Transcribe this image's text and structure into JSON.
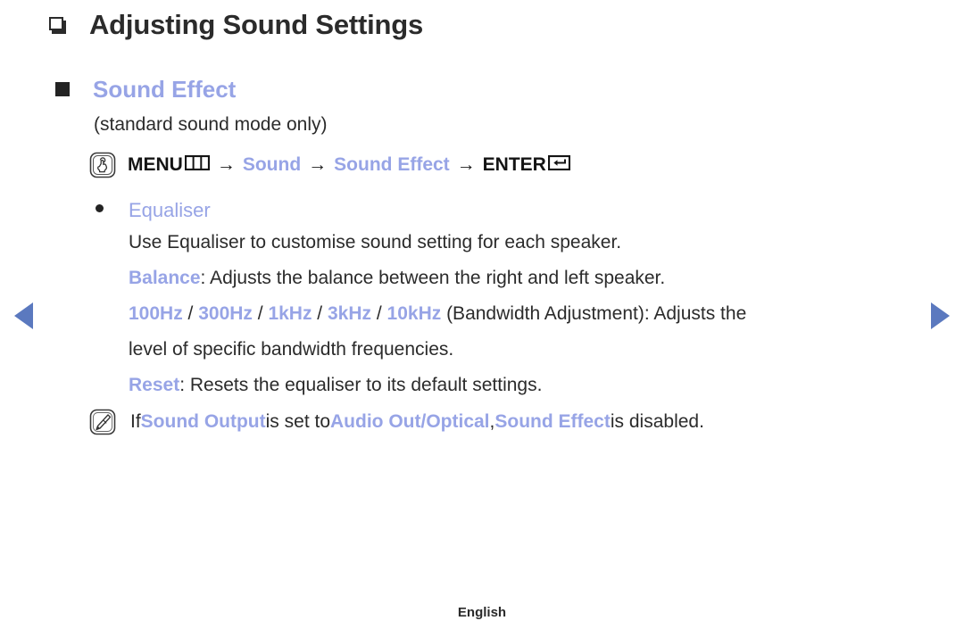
{
  "page": {
    "title": "Adjusting Sound Settings",
    "title_bullet_icon": "hollow-square-bullet-icon",
    "footer_language": "English"
  },
  "section": {
    "bullet_icon": "filled-square-bullet-icon",
    "heading": "Sound Effect",
    "subnote": "(standard sound mode only)"
  },
  "menu_path": {
    "press_icon": "hand-press-icon",
    "menu_label": "MENU",
    "menu_icon": "menu-grid-icon",
    "arrow": "→",
    "step_sound": "Sound",
    "step_sound_effect": "Sound Effect",
    "enter_label": "ENTER",
    "enter_icon": "enter-return-icon"
  },
  "detail": {
    "bullet_icon": "round-dot-bullet-icon",
    "heading": "Equaliser",
    "line1": "Use Equaliser to customise sound setting for each speaker.",
    "line2_term": "Balance",
    "line2_rest": ": Adjusts the balance between the right and left speaker.",
    "freqs": [
      "100Hz",
      "300Hz",
      "1kHz",
      "3kHz",
      "10kHz"
    ],
    "freq_separator": " / ",
    "line3_rest": " (Bandwidth Adjustment): Adjusts the",
    "line4": "level of specific bandwidth frequencies.",
    "line5_term": "Reset",
    "line5_rest": ": Resets the equaliser to its default settings."
  },
  "note": {
    "icon": "note-pencil-icon",
    "prefix": "If ",
    "term1": "Sound Output",
    "middle1": " is set to ",
    "term2": "Audio Out/Optical",
    "middle2": ", ",
    "term3": "Sound Effect",
    "suffix": " is disabled."
  },
  "nav": {
    "prev_icon": "previous-page-arrow-icon",
    "next_icon": "next-page-arrow-icon"
  },
  "colors": {
    "accent_blue": "#97a4e6",
    "nav_blue": "#5b79bf",
    "text_dark": "#2b2b2b"
  }
}
